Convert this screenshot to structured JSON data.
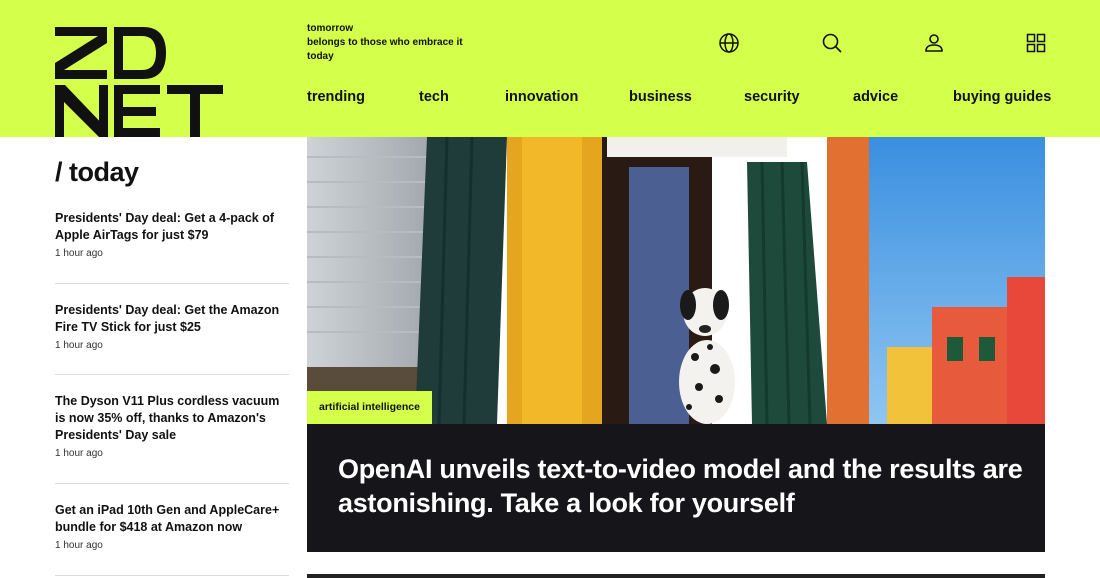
{
  "brand": {
    "logo_line1": "ZD",
    "logo_line2": "NET",
    "accent_color": "#d4ff4a",
    "tagline": [
      "tomorrow",
      "belongs to those who embrace it",
      "today"
    ]
  },
  "header_icons": [
    "globe-icon",
    "search-icon",
    "user-icon",
    "grid-menu-icon"
  ],
  "nav": [
    "trending",
    "tech",
    "innovation",
    "business",
    "security",
    "advice",
    "buying guides"
  ],
  "sidebar": {
    "title": "/ today",
    "stories": [
      {
        "headline": "Presidents' Day deal: Get a 4-pack of Apple AirTags for just $79",
        "time": "1 hour ago"
      },
      {
        "headline": "Presidents' Day deal: Get the Amazon Fire TV Stick for just $25",
        "time": "1 hour ago"
      },
      {
        "headline": "The Dyson V11 Plus cordless vacuum is now 35% off, thanks to Amazon's Presidents' Day sale",
        "time": "1 hour ago"
      },
      {
        "headline": "Get an iPad 10th Gen and AppleCare+ bundle for $418 at Amazon now",
        "time": "1 hour ago"
      }
    ]
  },
  "hero": {
    "tag": "artificial intelligence",
    "headline": "OpenAI unveils text-to-video model and the results are astonishing. Take a look for yourself"
  }
}
